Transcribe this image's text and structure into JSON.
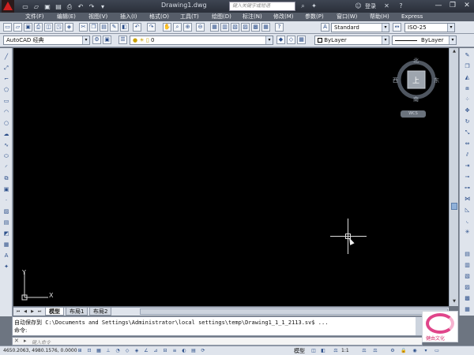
{
  "window": {
    "title": "Drawing1.dwg",
    "search_placeholder": "键入关键字或短语",
    "login_label": "登录",
    "controls": {
      "minimize": "—",
      "restore": "❐",
      "close": "✕"
    }
  },
  "menu": {
    "items": [
      "文件(F)",
      "编辑(E)",
      "视图(V)",
      "插入(I)",
      "格式(O)",
      "工具(T)",
      "绘图(D)",
      "标注(N)",
      "修改(M)",
      "参数(P)",
      "窗口(W)",
      "帮助(H)",
      "Express"
    ]
  },
  "toolbar": {
    "text_style": "Standard",
    "dim_style": "ISO-25",
    "workspace": "AutoCAD 经典",
    "layer": "0",
    "color": "ByLayer",
    "linetype": "ByLayer"
  },
  "viewcube": {
    "north": "北",
    "south": "南",
    "east": "东",
    "west": "西",
    "face": "上",
    "wcs": "WCS"
  },
  "ucs": {
    "x_label": "X",
    "y_label": "Y"
  },
  "tabs": [
    "模型",
    "布局1",
    "布局2"
  ],
  "command": {
    "history_line": "自动保存到 C:\\Documents and Settings\\Administrator\\local settings\\temp\\Drawing1_1_1_2113.sv$ ...",
    "prompt_line": "命令:",
    "input_placeholder": "键入命令"
  },
  "status": {
    "coordinates": "4650.2063, 4980.1576, 0.0000",
    "model_label": "模型",
    "scale": "1:1"
  },
  "watermark": {
    "text": "健由文化"
  },
  "colors": {
    "canvas": "#000000",
    "titlebar": "#2f3540",
    "toolbar": "#dfe4ec",
    "crosshair": "#dddddd"
  }
}
